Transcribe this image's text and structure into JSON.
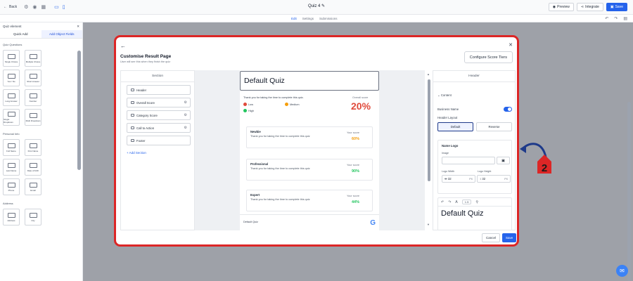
{
  "topbar": {
    "back_label": "Back",
    "quiz_title": "Quiz 4",
    "preview_label": "Preview",
    "integrate_label": "Integrate",
    "save_label": "Save"
  },
  "subbar": {
    "tabs": [
      "Edit",
      "Settings",
      "Submissions"
    ]
  },
  "sidebar": {
    "header": "Quiz element",
    "tabs": [
      "Quick Add",
      "Add Object Fields"
    ],
    "quiz_questions_label": "Quiz Questions",
    "quiz_tiles": [
      "Single Choice",
      "Multiple Choice",
      "Yes / No",
      "Short Answer",
      "Long Answer",
      "Number",
      "Single Dropdown",
      "Multi Dropdown"
    ],
    "personal_info_label": "Personal Info",
    "personal_tiles": [
      "Full Name",
      "First Name",
      "Last Name",
      "Date of birth",
      "Phone",
      "Email"
    ],
    "address_label": "Address",
    "address_tiles": [
      "Address",
      "City"
    ]
  },
  "modal": {
    "title": "Customise Result Page",
    "subtitle": "User will see this when they finish the quiz",
    "configure_button": "Configure Score Tiers",
    "sections_header": "Section",
    "sections": [
      "Header",
      "Overall Score",
      "Category Score",
      "Call to Action",
      "Footer"
    ],
    "add_section": "+ Add Section",
    "cancel_label": "Cancel",
    "save_label": "Save"
  },
  "preview": {
    "quiz_title": "Default Quiz",
    "thanks_text": "Thank you for taking the time to complete this quiz.",
    "legend": [
      {
        "label": "Low",
        "color": "#e04a3b"
      },
      {
        "label": "Medium",
        "color": "#f59e0b"
      },
      {
        "label": "High",
        "color": "#22c55e"
      }
    ],
    "overall_label": "Overall score",
    "overall_value": "20%",
    "tiers": [
      {
        "name": "Newbie",
        "desc": "Thank you for taking the time to complete this quiz",
        "your_score": "Your score",
        "score": "60%",
        "color": "#f59e0b"
      },
      {
        "name": "Professional",
        "desc": "Thank you for taking the time to complete this quiz",
        "your_score": "Your score",
        "score": "90%",
        "color": "#22c55e"
      },
      {
        "name": "Expert",
        "desc": "Thank you for taking the time to complete this quiz",
        "your_score": "Your score",
        "score": "44%",
        "color": "#22c55e"
      }
    ],
    "footer_text": "Default Quiz",
    "footer_logo": "G"
  },
  "right_panel": {
    "header": "Header",
    "content_label": "Content",
    "business_name_label": "Business Name",
    "header_layout_label": "Header Layout",
    "layout_options": [
      "Default",
      "Reverse"
    ],
    "name_logo_label": "Name Logo",
    "image_label": "Image",
    "logo_width_label": "Logo Width",
    "logo_height_label": "Logo Height",
    "logo_width_value": "32",
    "logo_height_value": "32",
    "unit": "PX",
    "font_size": "1.5",
    "editor_text": "Default Quiz"
  },
  "annotation": {
    "number": "2",
    "color": "#dc2626"
  }
}
